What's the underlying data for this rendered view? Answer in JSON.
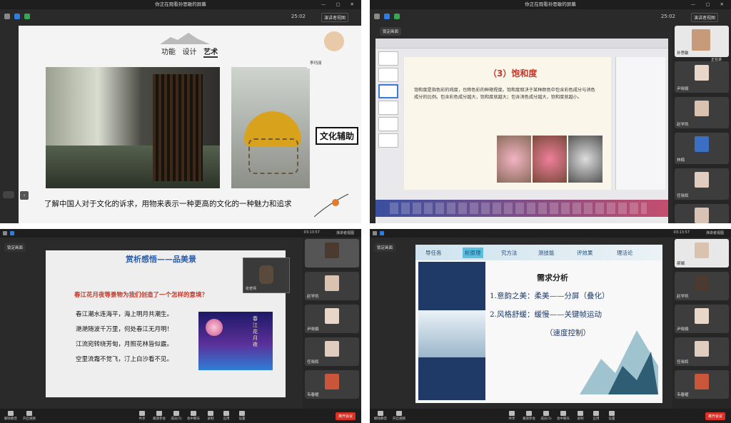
{
  "q1": {
    "window_title": "你正在观看孙思敏的屏幕",
    "clock": "25:02",
    "view_label": "演讲者视图",
    "speaker": "李玛丽",
    "slide": {
      "nav": [
        "功能",
        "设计",
        "艺术"
      ],
      "callout": "文化辅助",
      "caption": "了解中国人对于文化的诉求，用物来表示一种更高的文化的一种魅力和追求"
    }
  },
  "q2": {
    "window_title": "你正在观看孙思敏的屏幕",
    "clock": "25:02",
    "view_label": "演讲者视图",
    "lock_label": "锁定画面",
    "speaking": "正在讲",
    "participants": [
      "孙思敏",
      "尹晓娟",
      "赵学凯",
      "林楠",
      "任晓辉"
    ],
    "slide": {
      "title": "（3）饱和度",
      "bullet": "饱和度是指色彩的纯度，也称色彩的鲜艳程度。饱和度取决于某种颜色中包含彩色成分与消色成分的比例。包含彩色成分越大，饱和度就越大；包含消色成分越大，饱和度就越小。"
    }
  },
  "q3": {
    "clock": "03:13:57",
    "view_label": "演讲者视图",
    "lock_label": "锁定画面",
    "speaker_pip": "张老师",
    "participants": [
      "赵学凯",
      "尹晓娟",
      "任晓辉",
      "韦春耀"
    ],
    "slide": {
      "title": "赏析感悟——品美景",
      "question": "春江花月夜等景物为我们创造了一个怎样的意境？",
      "lines": [
        "春江潮水连海平，海上明月共潮生。",
        "滟滟随波千万里，何处春江无月明！",
        "江流宛转绕芳甸，月照花林皆似霰。",
        "空里流霜不觉飞，汀上白沙看不见。"
      ],
      "painting_caption": "春江花月夜"
    },
    "toolbar": [
      "解除静音",
      "开启视频",
      "共享",
      "邀请参会",
      "成员(5)",
      "会中聊天",
      "录制",
      "应用",
      "设置"
    ],
    "end_label": "离开会议"
  },
  "q4": {
    "clock": "03:13:57",
    "view_label": "演讲者视图",
    "lock_label": "锁定画面",
    "participants": [
      "郝娟",
      "赵学凯",
      "尹晓娟",
      "任晓辉",
      "韦春耀"
    ],
    "slide": {
      "nav": [
        "导任务",
        "析原理",
        "究方法",
        "测技能",
        "评效果",
        "理活论"
      ],
      "heading": "需求分析",
      "item1": "1.意韵之美：柔美——分屏（叠化）",
      "item2": "2.风格舒缓：缓慢——关键帧运动",
      "item3": "（速度控制）"
    },
    "toolbar": [
      "解除静音",
      "开启视频",
      "共享",
      "邀请参会",
      "成员(5)",
      "会中聊天",
      "录制",
      "应用",
      "设置"
    ],
    "end_label": "离开会议"
  }
}
